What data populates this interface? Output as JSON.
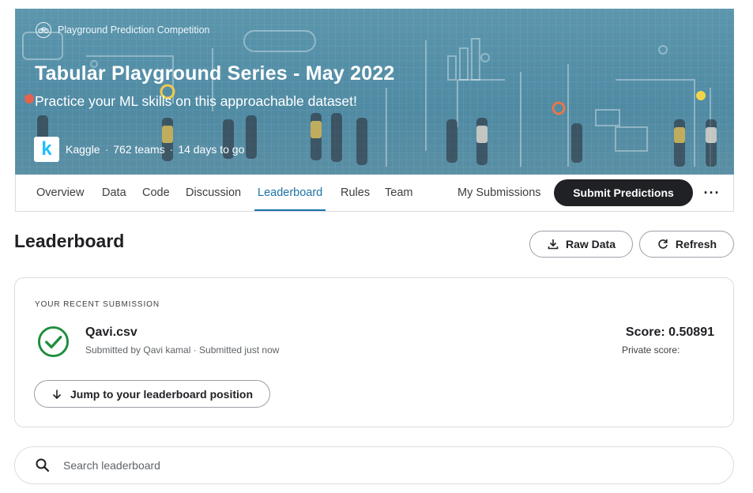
{
  "banner": {
    "competition_type": "Playground Prediction Competition",
    "title": "Tabular Playground Series - May 2022",
    "subtitle": "Practice your ML skills on this approachable dataset!",
    "host_logo_letter": "k",
    "host": "Kaggle",
    "separator": "·",
    "teams": "762 teams",
    "deadline": "14 days to go",
    "background_color": "#5b96ad"
  },
  "tabs": [
    {
      "label": "Overview"
    },
    {
      "label": "Data"
    },
    {
      "label": "Code"
    },
    {
      "label": "Discussion"
    },
    {
      "label": "Leaderboard",
      "active": true
    },
    {
      "label": "Rules"
    },
    {
      "label": "Team"
    },
    {
      "label": "My Submissions"
    }
  ],
  "actions": {
    "submit_label": "Submit Predictions",
    "more_label": "···"
  },
  "leaderboard": {
    "title": "Leaderboard",
    "raw_data_label": "Raw Data",
    "refresh_label": "Refresh"
  },
  "submission": {
    "section_label": "YOUR RECENT SUBMISSION",
    "file_name": "Qavi.csv",
    "meta": "Submitted by Qavi kamal · Submitted just now",
    "score": "Score: 0.50891",
    "private_score": "Private score:",
    "jump_label": "Jump to your leaderboard position",
    "status_icon": "check-circle-icon",
    "status_color": "#1e8e3e"
  },
  "search": {
    "placeholder": "Search leaderboard",
    "value": ""
  },
  "colors": {
    "accent": "#1a73a7",
    "dark_button": "#202124"
  }
}
